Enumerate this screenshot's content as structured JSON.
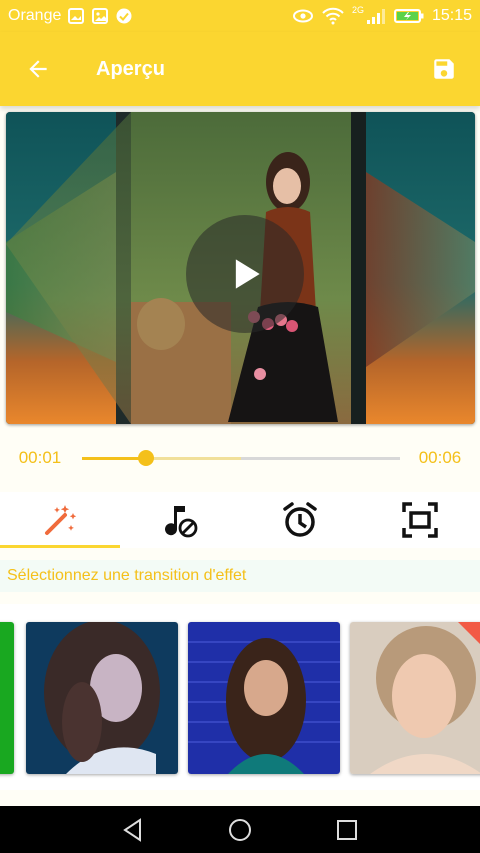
{
  "status": {
    "carrier": "Orange",
    "network": "2G",
    "time": "15:15"
  },
  "toolbar": {
    "title": "Aperçu",
    "back_icon": "arrow-back-icon",
    "save_icon": "floppy-disk-icon"
  },
  "player": {
    "current_time": "00:01",
    "total_time": "00:06",
    "progress": 0.2,
    "buffered": 0.5
  },
  "tabs": [
    {
      "icon": "magic-wand-icon",
      "active": true
    },
    {
      "icon": "music-off-icon",
      "active": false
    },
    {
      "icon": "alarm-clock-icon",
      "active": false
    },
    {
      "icon": "crop-frame-icon",
      "active": false
    }
  ],
  "hint": "Sélectionnez une transition d'effet",
  "colors": {
    "accent": "#fbd630",
    "accent_text": "#f4c01a",
    "selection": "#f25a45"
  }
}
